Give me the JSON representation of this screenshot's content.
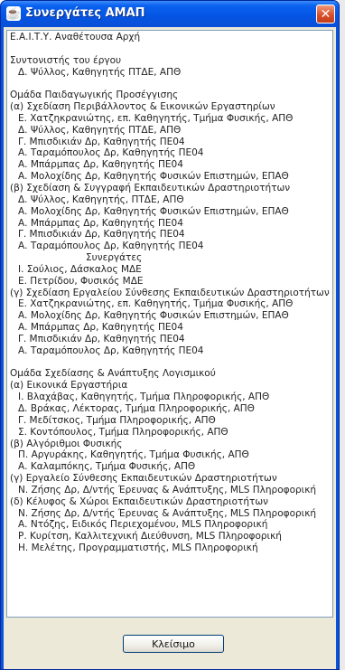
{
  "window": {
    "title": "Συνεργάτες ΑΜΑΠ",
    "close_glyph": "✕",
    "app_icon": "java-cup-icon"
  },
  "content_lines": [
    {
      "text": "Ε.Α.Ι.Τ.Υ. Αναθέτουσα Αρχή",
      "indent": 0
    },
    {
      "text": "",
      "indent": 0
    },
    {
      "text": "Συντονιστής του έργου",
      "indent": 0
    },
    {
      "text": "Δ. Ψύλλος, Καθηγητής ΠΤΔΕ, ΑΠΘ",
      "indent": 1
    },
    {
      "text": "",
      "indent": 0
    },
    {
      "text": "Ομάδα Παιδαγωγικής Προσέγγισης",
      "indent": 0
    },
    {
      "text": "(α) Σχεδίαση Περιβάλλοντος & Εικονικών Εργαστηρίων",
      "indent": 0
    },
    {
      "text": "Ε. Χατζηκρανιώτης, επ. Καθηγητής, Τμήμα Φυσικής, ΑΠΘ",
      "indent": 1
    },
    {
      "text": "Δ. Ψύλλος, Καθηγητής ΠΤΔΕ, ΑΠΘ",
      "indent": 1
    },
    {
      "text": "Γ. Μπισδικιάν Δρ, Καθηγητής ΠΕ04",
      "indent": 1
    },
    {
      "text": "Α. Ταραμόπουλος Δρ, Καθηγητής ΠΕ04",
      "indent": 1
    },
    {
      "text": "Α. Μπάρμπας Δρ, Καθηγητής ΠΕ04",
      "indent": 1
    },
    {
      "text": "Α. Μολοχίδης Δρ, Καθηγητής Φυσικών Επιστημών, ΕΠΑΘ",
      "indent": 1
    },
    {
      "text": "(β) Σχεδίαση & Συγγραφή Εκπαιδευτικών Δραστηριοτήτων",
      "indent": 0
    },
    {
      "text": "Δ. Ψύλλος, Καθηγητής, ΠΤΔΕ, ΑΠΘ",
      "indent": 1
    },
    {
      "text": "Α. Μολοχίδης Δρ, Καθηγητής Φυσικών Επιστημών, ΕΠΑΘ",
      "indent": 1
    },
    {
      "text": "Α. Μπάρμπας Δρ, Καθηγητής ΠΕ04",
      "indent": 1
    },
    {
      "text": "Γ. Μπισδικιάν Δρ, Καθηγητής ΠΕ04",
      "indent": 1
    },
    {
      "text": "Α. Ταραμόπουλος Δρ, Καθηγητής ΠΕ04",
      "indent": 1
    },
    {
      "text": "Συνεργάτες",
      "indent": 2
    },
    {
      "text": "Ι. Σούλιος, Δάσκαλος ΜΔΕ",
      "indent": 1
    },
    {
      "text": "Ε. Πετρίδου, Φυσικός ΜΔΕ",
      "indent": 1
    },
    {
      "text": "(γ) Σχεδίαση Εργαλείου Σύνθεσης Εκπαιδευτικών Δραστηριοτήτων",
      "indent": 0
    },
    {
      "text": "Ε. Χατζηκρανιώτης, επ. Καθηγητής, Τμήμα Φυσικής, ΑΠΘ",
      "indent": 1
    },
    {
      "text": "Α. Μολοχίδης Δρ, Καθηγητής Φυσικών Επιστημών, ΕΠΑΘ",
      "indent": 1
    },
    {
      "text": "Α. Μπάρμπας Δρ, Καθηγητής ΠΕ04",
      "indent": 1
    },
    {
      "text": "Γ. Μπισδικιάν Δρ, Καθηγητής ΠΕ04",
      "indent": 1
    },
    {
      "text": "Α. Ταραμόπουλος Δρ, Καθηγητής ΠΕ04",
      "indent": 1
    },
    {
      "text": "",
      "indent": 0
    },
    {
      "text": "Ομάδα Σχεδίασης & Ανάπτυξης Λογισμικού",
      "indent": 0
    },
    {
      "text": "(α) Εικονικά Εργαστήρια",
      "indent": 0
    },
    {
      "text": "Ι. Βλαχάβας, Καθηγητής, Τμήμα Πληροφορικής, ΑΠΘ",
      "indent": 1
    },
    {
      "text": "Δ. Βράκας, Λέκτορας, Τμήμα Πληροφορικής, ΑΠΘ",
      "indent": 1
    },
    {
      "text": "Γ. Μεδίτσκος, Τμήμα Πληροφορικής, ΑΠΘ",
      "indent": 1
    },
    {
      "text": "Σ. Κοντόπουλος, Τμήμα Πληροφορικής, ΑΠΘ",
      "indent": 1
    },
    {
      "text": "(β) Αλγόριθμοι Φυσικής",
      "indent": 0
    },
    {
      "text": "Π. Αργυράκης, Καθηγητής, Τμήμα Φυσικής, ΑΠΘ",
      "indent": 1
    },
    {
      "text": "Α. Καλαμπόκης, Τμήμα Φυσικής, ΑΠΘ",
      "indent": 1
    },
    {
      "text": "(γ) Εργαλείο Σύνθεσης Εκπαιδευτικών Δραστηριοτήτων",
      "indent": 0
    },
    {
      "text": "Ν. Ζήσης Δρ, Δ/ντής Έρευνας & Ανάπτυξης, MLS Πληροφορική",
      "indent": 1
    },
    {
      "text": "(δ) Κέλυφος & Χώροι Εκπαιδευτικών Δραστηριοτήτων",
      "indent": 0
    },
    {
      "text": "Ν. Ζήσης Δρ, Δ/ντής Έρευνας & Ανάπτυξης, MLS Πληροφορική",
      "indent": 1
    },
    {
      "text": "Α. Ντόζης, Ειδικός Περιεχομένου, MLS Πληροφορική",
      "indent": 1
    },
    {
      "text": "Ρ. Κυρίτση, Καλλιτεχνική Διεύθυνση, MLS Πληροφορική",
      "indent": 1
    },
    {
      "text": "Η. Μελέτης, Προγραμματιστής, MLS Πληροφορική",
      "indent": 1
    }
  ],
  "buttons": {
    "close_label": "Κλείσιμο"
  }
}
